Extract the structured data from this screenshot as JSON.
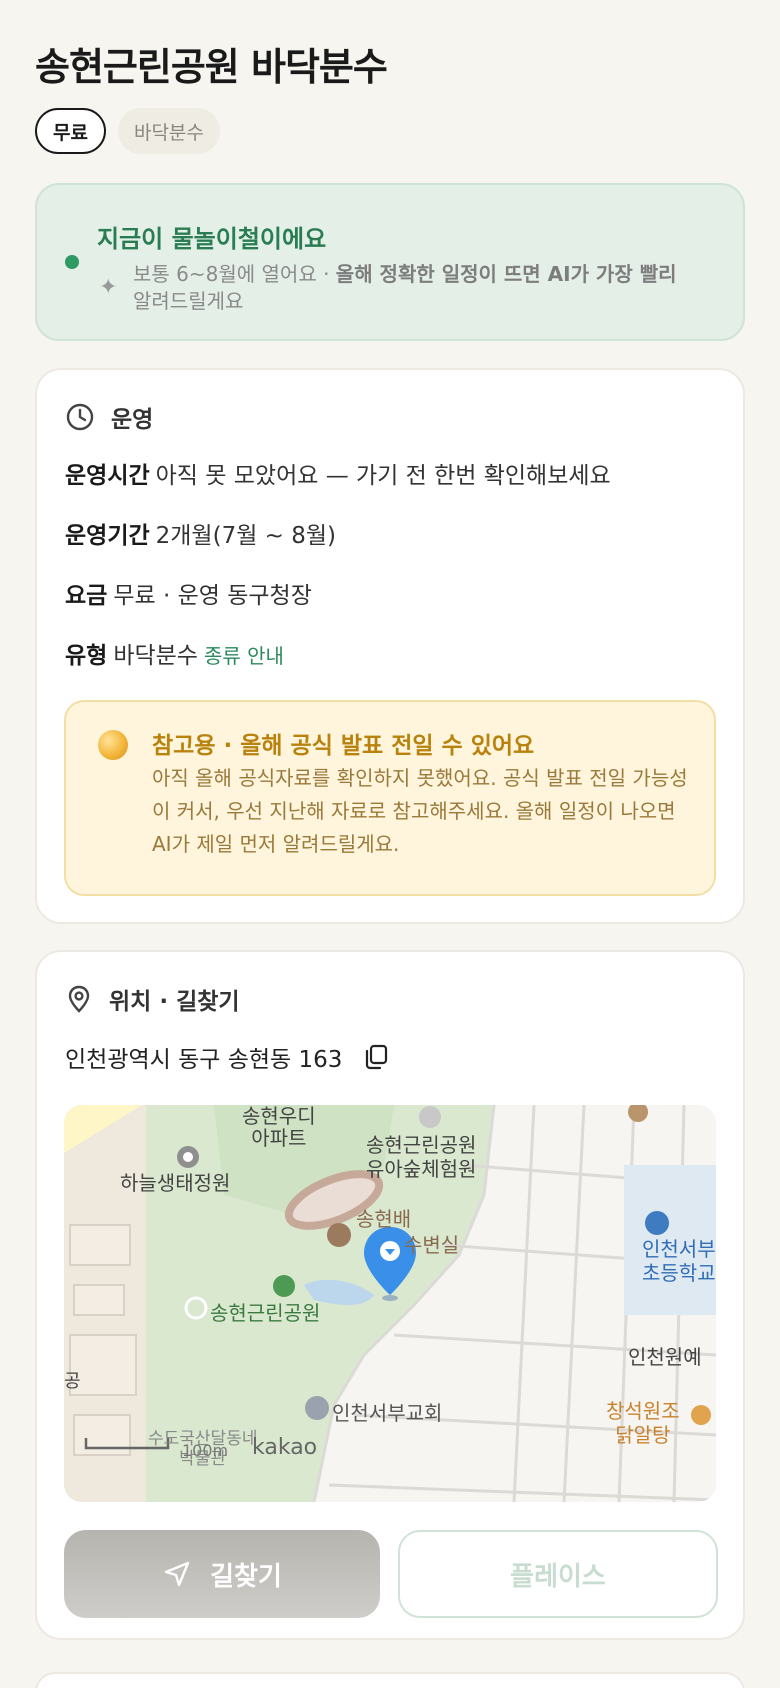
{
  "header": {
    "title": "송현근린공원 바닥분수",
    "chips": [
      "무료",
      "바닥분수"
    ]
  },
  "season_banner": {
    "headline": "지금이 물놀이철이에요",
    "sub_prefix": "보통 6~8월에 열어요 · ",
    "sub_bold": "올해 정확한 일정이 뜨면 AI가 가장 빨리",
    "sub_suffix": "알려드릴게요",
    "accent_color": "#2f9a62"
  },
  "operation": {
    "section_label": "운영",
    "icon": "clock-icon",
    "rows": [
      {
        "key": "운영시간",
        "value": "아직 못 모았어요 — 가기 전 한번 확인해보세요"
      },
      {
        "key": "운영기간",
        "value": "2개월(7월 ~ 8월)"
      },
      {
        "key": "요금",
        "value": "무료 · 운영 동구청장"
      },
      {
        "key": "유형",
        "value": "바닥분수",
        "link": "종류 안내"
      }
    ],
    "notice": {
      "headline": "참고용 · 올해 공식 발표 전일 수 있어요",
      "body": "아직 올해 공식자료를 확인하지 못했어요. 공식 발표 전일 가능성이 커서, 우선 지난해 자료로 참고해주세요. 올해 일정이 나오면 AI가 제일 먼저 알려드릴게요.",
      "color": "#b8820c"
    }
  },
  "location": {
    "section_label": "위치 · 길찾기",
    "icon": "location-pin-icon",
    "address": "인천광역시 동구 송현동 163",
    "map": {
      "labels": {
        "apt": "송현우디\n아파트",
        "haneul": "하늘생태정원",
        "forest": "송현근린공원\n유아숲체험원",
        "songhyeonbae": "송현배",
        "susubyeon": "수변실",
        "park": "송현근린공원",
        "school": "인천서부\n초등학교",
        "incheon_won": "인천원예",
        "gong": "공",
        "church": "인천서부교회",
        "restaurant": "창석원조\n닭알탕",
        "museum": "수도국산달동네\n박물관",
        "scale": "100m",
        "brand": "kakao"
      }
    },
    "buttons": {
      "navigate": "길찾기",
      "place": "플레이스"
    }
  }
}
